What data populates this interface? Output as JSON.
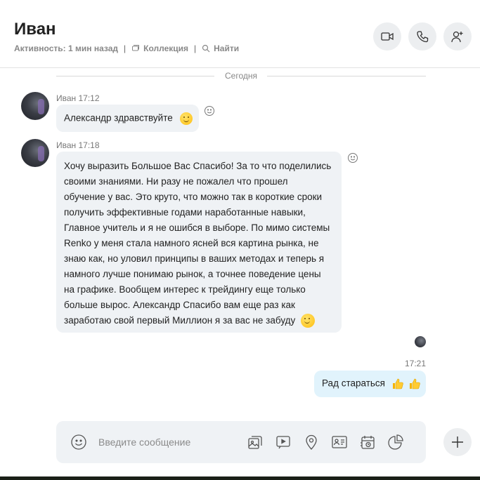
{
  "header": {
    "title": "Иван",
    "activity": "Активность: 1 мин назад",
    "separator": "|",
    "collection_label": "Коллекция",
    "find_label": "Найти",
    "icons": [
      "video-call-icon",
      "audio-call-icon",
      "add-person-icon"
    ]
  },
  "divider": {
    "label": "Сегодня"
  },
  "messages": [
    {
      "sender": "Иван 17:12",
      "text": "Александр здравствуйте",
      "emoji": "smile"
    },
    {
      "sender": "Иван 17:18",
      "lines": [
        "Хочу выразить Большое Вас Спасибо! За то что поделились",
        "своими знаниями. Ни разу не пожалел что прошел",
        "обучение у вас. Это круто, что можно так в короткие сроки",
        "получить эффективные годами наработанные навыки,",
        "Главное учитель и я не ошибся в выборе. По мимо системы",
        "Renko у меня стала намного ясней вся картина рынка, не",
        "знаю как, но уловил принципы в ваших методах и теперь я",
        "намного лучше понимаю рынок, а точнее поведение цены",
        "на графике. Вообщем интерес к трейдингу еще только",
        "больше вырос. Александр Спасибо вам еще раз как",
        "заработаю свой первый Миллион я за вас не забуду"
      ],
      "emoji": "smile"
    }
  ],
  "outgoing": {
    "time": "17:21",
    "text": "Рад стараться",
    "emojis": [
      "thumbs-up",
      "thumbs-up"
    ]
  },
  "composer": {
    "placeholder": "Введите сообщение",
    "icons": [
      "emoji-icon",
      "media-icon",
      "video-message-icon",
      "location-icon",
      "contact-card-icon",
      "schedule-icon",
      "poll-icon"
    ]
  },
  "colors": {
    "incoming_bubble": "#eff2f5",
    "outgoing_bubble": "#e1f3fc",
    "button_bg": "#eceef0"
  }
}
